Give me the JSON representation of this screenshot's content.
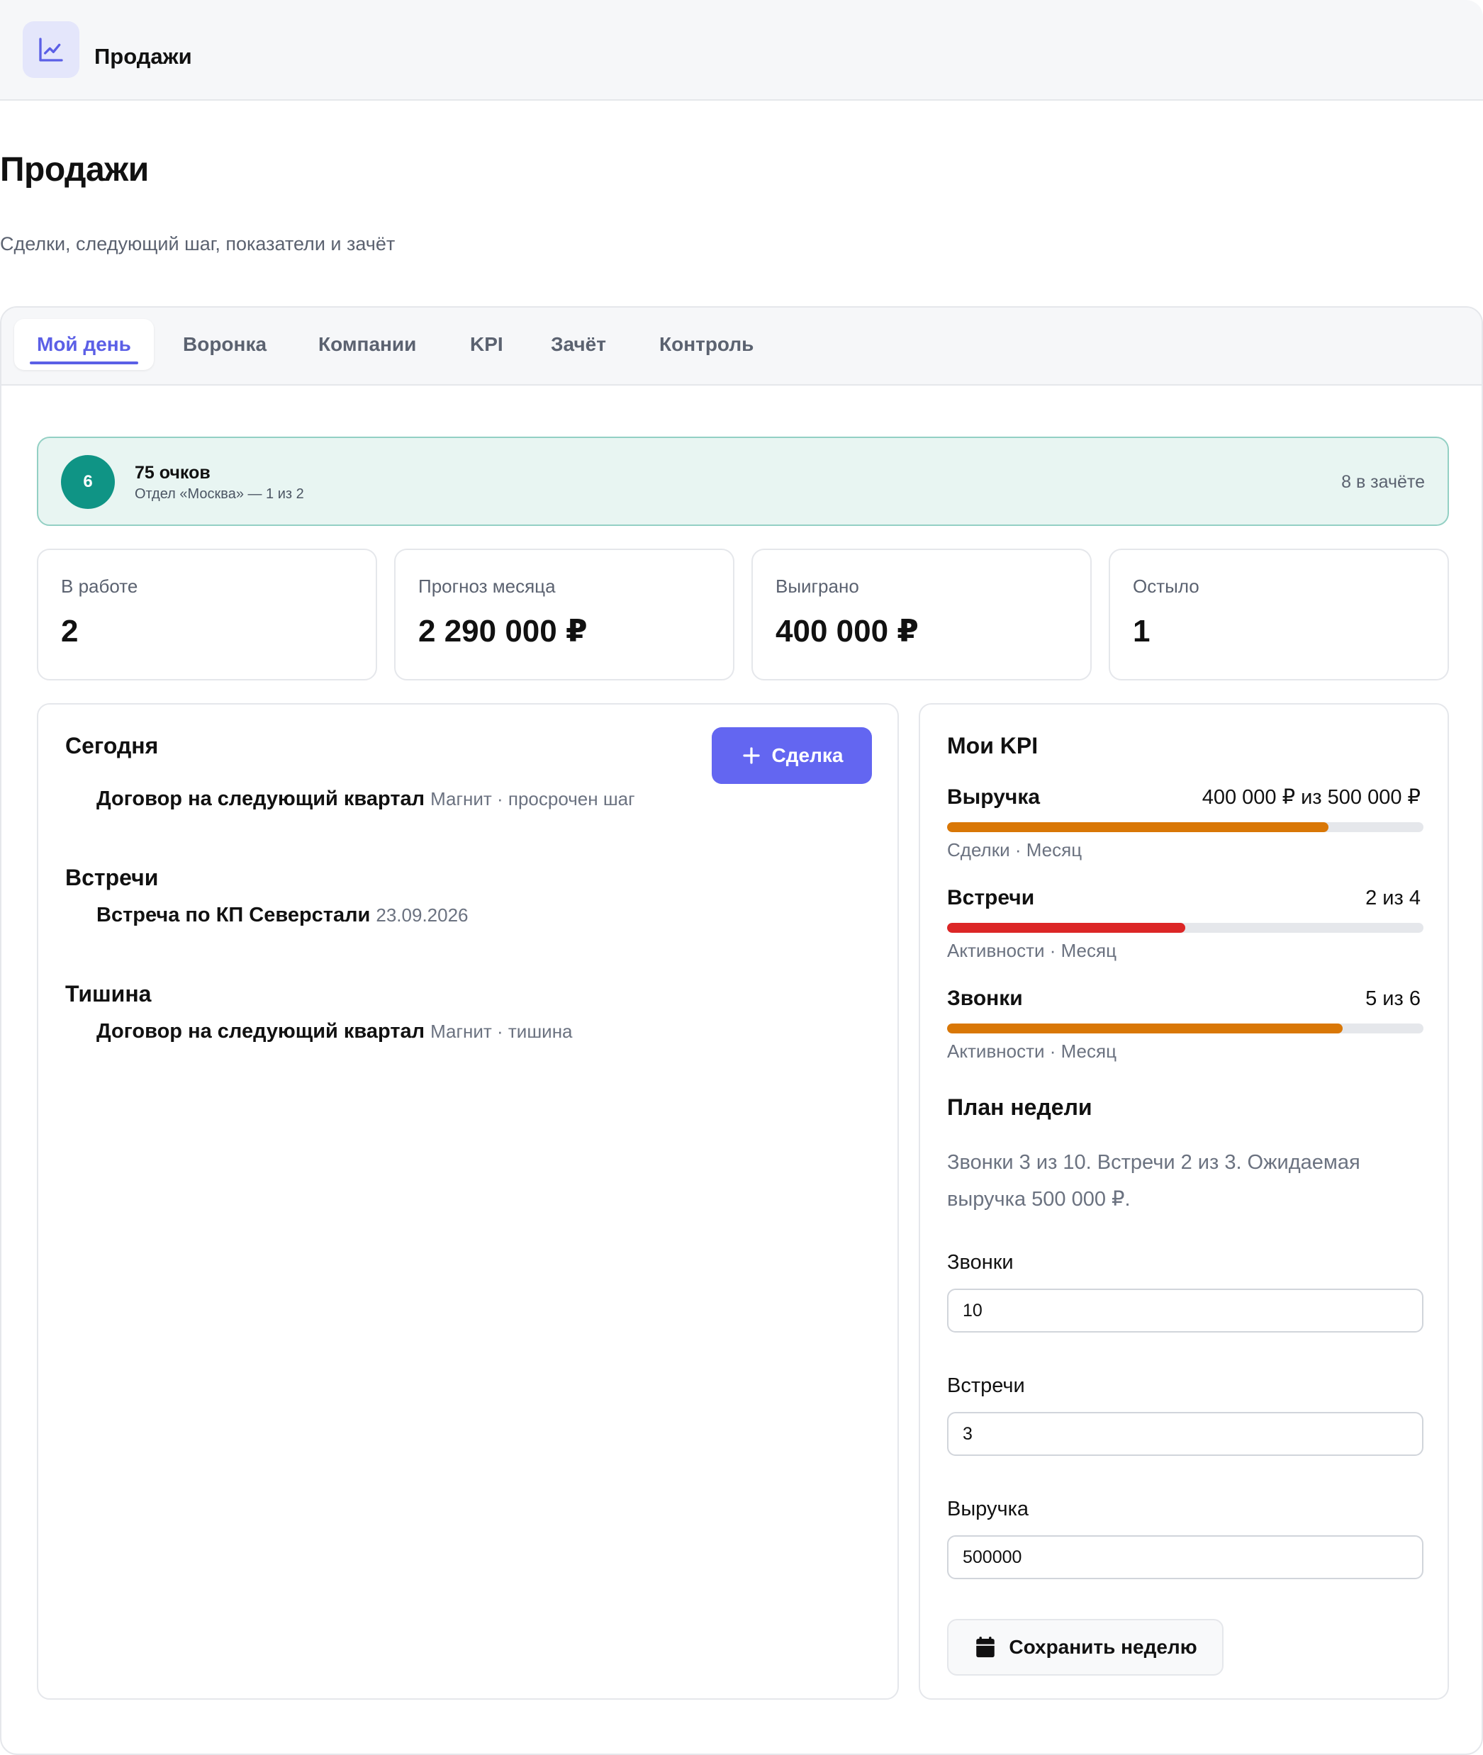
{
  "app": {
    "title": "Продажи",
    "logo_icon": "chart-line-icon"
  },
  "page": {
    "title": "Продажи",
    "subtitle": "Сделки, следующий шаг, показатели и зачёт"
  },
  "tabs": [
    {
      "label": "Мой день",
      "active": true
    },
    {
      "label": "Воронка"
    },
    {
      "label": "Компании"
    },
    {
      "label": "KPI"
    },
    {
      "label": "Зачёт"
    },
    {
      "label": "Контроль"
    }
  ],
  "score": {
    "rank": "6",
    "points": "75 очков",
    "department": "Отдел «Москва» — 1 из 2",
    "credit": "8 в зачёте"
  },
  "stats": [
    {
      "label": "В работе",
      "value": "2"
    },
    {
      "label": "Прогноз месяца",
      "value": "2 290 000 ₽"
    },
    {
      "label": "Выиграно",
      "value": "400 000 ₽"
    },
    {
      "label": "Остыло",
      "value": "1"
    }
  ],
  "today": {
    "title": "Сегодня",
    "add_button_label": "Сделка",
    "items": [
      {
        "name": "Договор на следующий квартал",
        "meta": "Магнит · просрочен шаг"
      }
    ]
  },
  "meetings": {
    "title": "Встречи",
    "items": [
      {
        "name": "Встреча по КП Северстали",
        "meta": "23.09.2026"
      }
    ]
  },
  "silence": {
    "title": "Тишина",
    "items": [
      {
        "name": "Договор на следующий квартал",
        "meta": "Магнит · тишина"
      }
    ]
  },
  "kpi": {
    "title": "Мои KPI",
    "items": [
      {
        "name": "Выручка",
        "value": "400 000 ₽ из 500 000 ₽",
        "sub": "Сделки · Месяц",
        "progress": 0.8,
        "color": "#d97706"
      },
      {
        "name": "Встречи",
        "value": "2 из 4",
        "sub": "Активности · Месяц",
        "progress": 0.5,
        "color": "#dc2626"
      },
      {
        "name": "Звонки",
        "value": "5 из 6",
        "sub": "Активности · Месяц",
        "progress": 0.83,
        "color": "#d97706"
      }
    ]
  },
  "week_plan": {
    "title": "План недели",
    "summary": "Звонки 3 из 10. Встречи 2 из 3. Ожидаемая выручка 500 000 ₽.",
    "fields": [
      {
        "label": "Звонки",
        "value": "10"
      },
      {
        "label": "Встречи",
        "value": "3"
      },
      {
        "label": "Выручка",
        "value": "500000"
      }
    ],
    "save_label": "Сохранить неделю"
  },
  "colors": {
    "accent": "#6366f1",
    "teal": "#0f9485",
    "warning": "#d97706",
    "danger": "#dc2626"
  }
}
